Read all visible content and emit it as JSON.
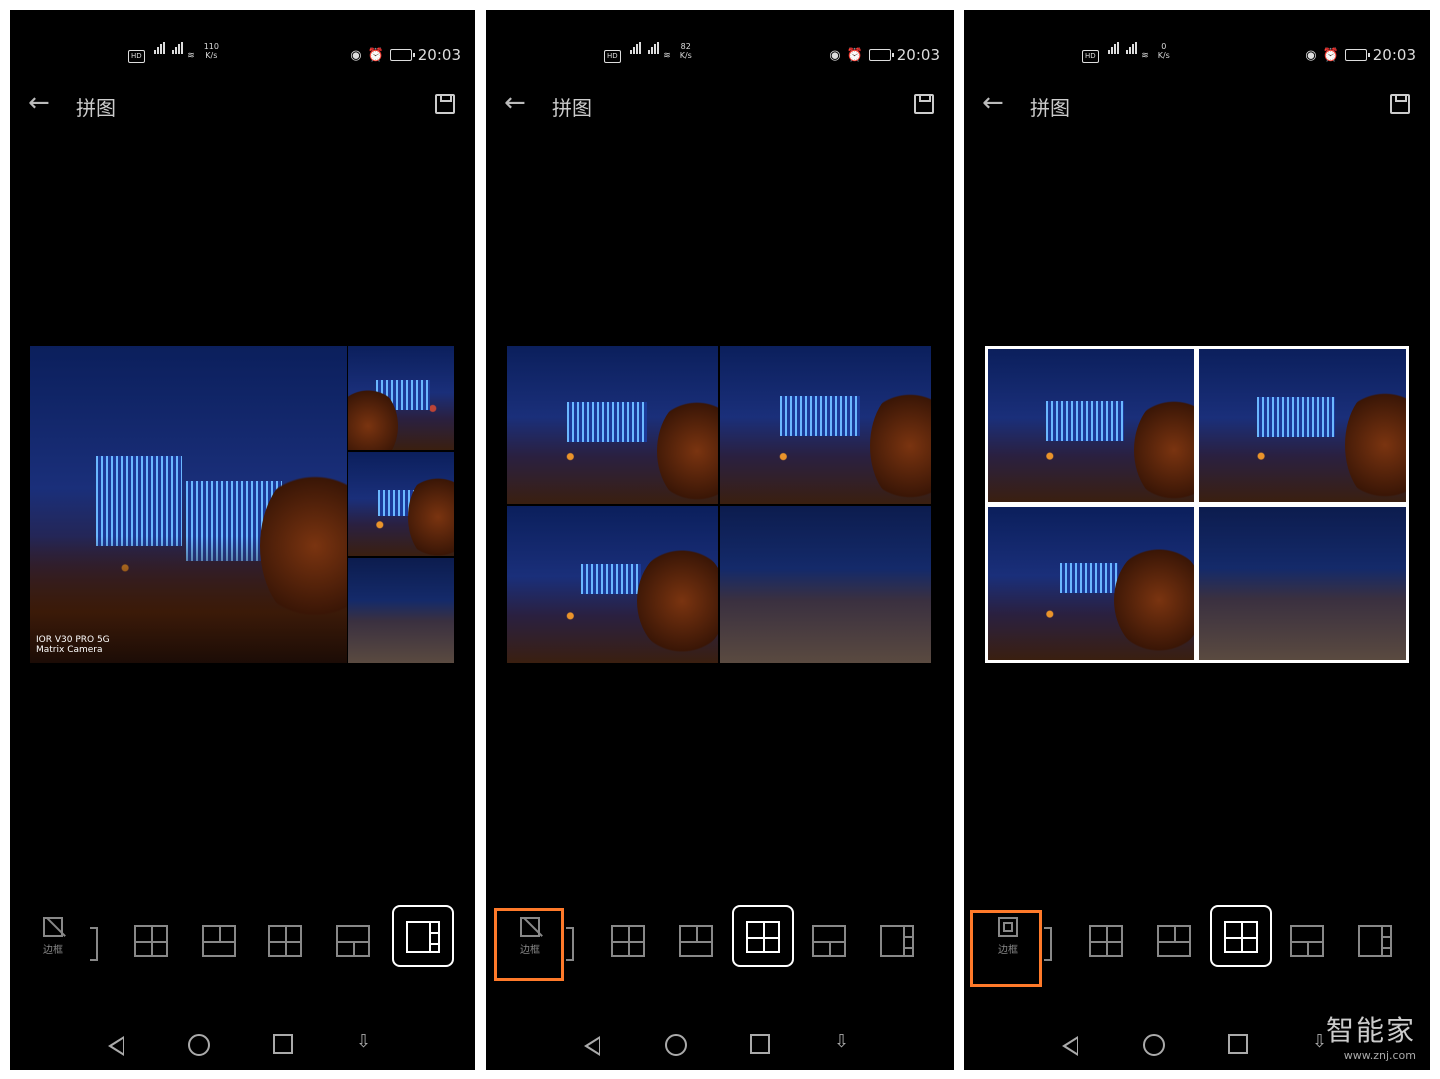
{
  "status": {
    "time": "20:03",
    "net_rates": [
      "110\nK/s",
      "82\nK/s",
      "0\nK/s"
    ],
    "net_type": [
      "4G",
      "5G"
    ],
    "hd_label": "HD"
  },
  "header": {
    "title": "拼图"
  },
  "collage": {
    "watermark_line1": "IOR V30 PRO 5G",
    "watermark_line2": "Matrix Camera"
  },
  "toolbar": {
    "border_label": "边框"
  },
  "accent_color": "#ff7a2a",
  "site_watermark": {
    "name": "智能家",
    "url": "www.znj.com"
  }
}
